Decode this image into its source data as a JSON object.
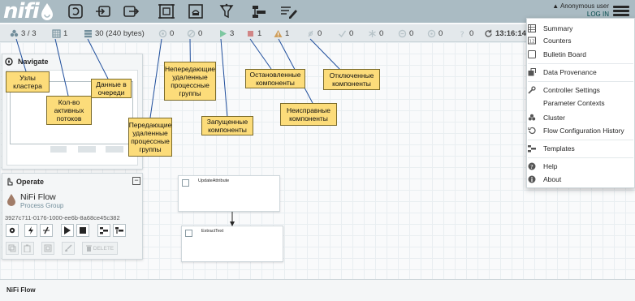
{
  "app": {
    "logo": "nifi"
  },
  "user": {
    "name": "Anonymous user",
    "login": "LOG IN"
  },
  "status": [
    {
      "name": "cluster-nodes",
      "value": "3 / 3"
    },
    {
      "name": "active-threads",
      "value": "1"
    },
    {
      "name": "queued-data",
      "value": "30 (240 bytes)"
    },
    {
      "name": "transmitting",
      "value": "0"
    },
    {
      "name": "not-transmitting",
      "value": "0"
    },
    {
      "name": "running",
      "value": "3"
    },
    {
      "name": "stopped",
      "value": "1"
    },
    {
      "name": "invalid",
      "value": "1"
    },
    {
      "name": "disabled",
      "value": "0"
    },
    {
      "name": "up-to-date",
      "value": "0"
    },
    {
      "name": "locally-modified",
      "value": "0"
    },
    {
      "name": "stale",
      "value": "0"
    },
    {
      "name": "locally-modified-stale",
      "value": "0"
    },
    {
      "name": "sync-failure",
      "value": "0"
    },
    {
      "name": "refresh-time",
      "value": "13:16:14"
    }
  ],
  "navigate": {
    "title": "Navigate"
  },
  "operate": {
    "title": "Operate",
    "flow_name": "NiFi Flow",
    "flow_type": "Process Group",
    "flow_id": "3927c711-0176-1000-ee6b-8a68ce45c382",
    "delete_label": "DELETE"
  },
  "processors": [
    {
      "name": "UpdateAttribute"
    },
    {
      "name": "ExtractText"
    }
  ],
  "breadcrumb": "NiFi Flow",
  "menu": {
    "items": [
      {
        "label": "Summary",
        "icon": "summary-icon"
      },
      {
        "label": "Counters",
        "icon": "counters-icon"
      },
      {
        "label": "Bulletin Board",
        "icon": "bulletin-board-icon"
      },
      {
        "label": "Data Provenance",
        "icon": "provenance-icon"
      },
      {
        "label": "Controller Settings",
        "icon": "wrench-icon"
      },
      {
        "label": "Parameter Contexts",
        "icon": ""
      },
      {
        "label": "Cluster",
        "icon": "cluster-icon"
      },
      {
        "label": "Flow Configuration History",
        "icon": "history-icon"
      },
      {
        "label": "Templates",
        "icon": "templates-icon"
      },
      {
        "label": "Help",
        "icon": "help-icon"
      },
      {
        "label": "About",
        "icon": "info-icon"
      }
    ]
  },
  "callouts": {
    "cluster_nodes": "Узлы\nкластера",
    "active_threads": "Кол-во\nактивных\nпотоков",
    "queued_data": "Данные в\nочереди",
    "transmitting_rpg": "Передающие\nудаленные\nпроцессные\nгруппы",
    "not_transmitting_rpg": "Непередающие\nудаленные\nпроцессные\nгруппы",
    "running": "Запущенные\nкомпоненты",
    "stopped": "Остановленные\nкомпоненты",
    "invalid": "Неисправные\nкомпоненты",
    "disabled": "Отключенные\nкомпоненты"
  },
  "colors": {
    "header": "#aabbc3",
    "callout": "#fcdc7a",
    "running": "#7dc7a0",
    "stopped": "#d18686",
    "invalid": "#cf9f5d",
    "text": "#262626"
  }
}
